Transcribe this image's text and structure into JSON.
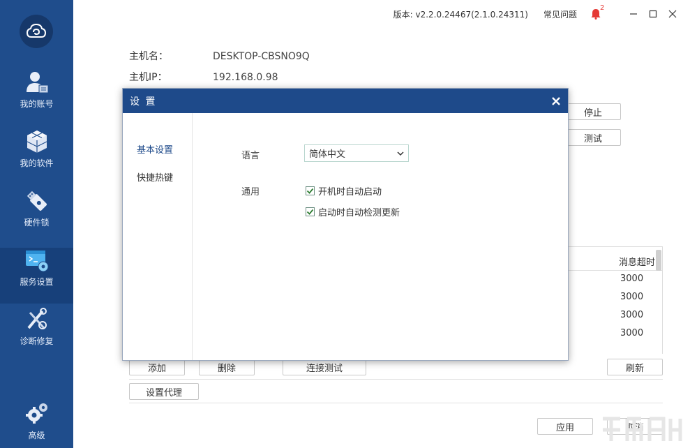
{
  "sidebar": {
    "items": [
      {
        "label": "我的账号",
        "icon": "user-icon"
      },
      {
        "label": "我的软件",
        "icon": "cubes-icon"
      },
      {
        "label": "硬件锁",
        "icon": "usb-key-icon"
      },
      {
        "label": "服务设置",
        "icon": "server-settings-icon",
        "active": true
      },
      {
        "label": "诊断修复",
        "icon": "repair-tools-icon"
      },
      {
        "label": "高级",
        "icon": "gears-icon"
      }
    ]
  },
  "topbar": {
    "version": "版本: v2.2.0.24467(2.1.0.24311)",
    "faq": "常见问题",
    "notification_count": "2"
  },
  "host": {
    "name_label": "主机名：",
    "name_value": "DESKTOP-CBSNO9Q",
    "ip_label": "主机IP：",
    "ip_value": "192.168.0.98"
  },
  "buttons": {
    "stop": "停止",
    "test": "测试",
    "add": "添加",
    "delete": "删除",
    "connection_test": "连接测试",
    "refresh": "刷新",
    "set_proxy": "设置代理",
    "apply": "应用",
    "cancel": "取消"
  },
  "table": {
    "header_right": "消息超时",
    "timeouts": [
      "3000",
      "3000",
      "3000",
      "3000"
    ]
  },
  "dialog": {
    "title": "设 置",
    "tabs": [
      "基本设置",
      "快捷热键"
    ],
    "language_label": "语言",
    "language_value": "简体中文",
    "general_label": "通用",
    "options": [
      {
        "label": "开机时自动启动",
        "checked": true
      },
      {
        "label": "启动时自动检测更新",
        "checked": true
      }
    ]
  },
  "colors": {
    "sidebar": "#1f4d8c",
    "dialog_header": "#1e4a8a",
    "badge": "#e53935"
  }
}
